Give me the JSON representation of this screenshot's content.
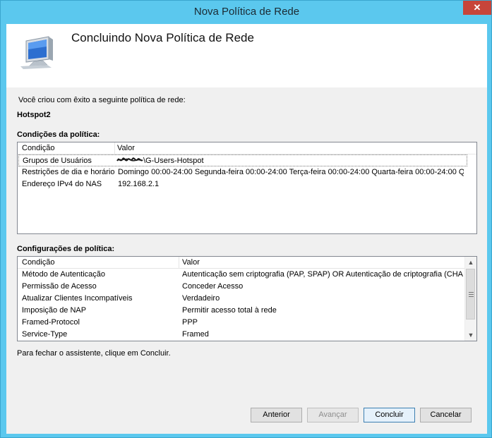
{
  "window": {
    "title": "Nova Política de Rede",
    "close_symbol": "✕"
  },
  "header": {
    "title": "Concluindo Nova Política de Rede",
    "icon": "monitor-icon"
  },
  "intro_text": "Você criou com êxito a seguinte política de rede:",
  "policy_name": "Hotspot2",
  "conditions": {
    "section_label": "Condições da política:",
    "columns": [
      "Condição",
      "Valor"
    ],
    "rows": [
      {
        "condition": "Grupos de Usuários",
        "value": "\\G-Users-Hotspot"
      },
      {
        "condition": "Restrições de dia e horário",
        "value": "Domingo 00:00-24:00 Segunda-feira 00:00-24:00 Terça-feira 00:00-24:00 Quarta-feira 00:00-24:00 Q..."
      },
      {
        "condition": "Endereço IPv4 do NAS",
        "value": "192.168.2.1"
      }
    ]
  },
  "settings": {
    "section_label": "Configurações de política:",
    "columns": [
      "Condição",
      "Valor"
    ],
    "rows": [
      {
        "condition": "Método de Autenticação",
        "value": "Autenticação sem criptografia (PAP, SPAP) OR Autenticação de criptografia (CHA..."
      },
      {
        "condition": "Permissão de Acesso",
        "value": "Conceder Acesso"
      },
      {
        "condition": "Atualizar Clientes Incompatíveis",
        "value": "Verdadeiro"
      },
      {
        "condition": "Imposição de NAP",
        "value": "Permitir acesso total à rede"
      },
      {
        "condition": "Framed-Protocol",
        "value": "PPP"
      },
      {
        "condition": "Service-Type",
        "value": "Framed"
      }
    ]
  },
  "footer_text": "Para fechar o assistente, clique em Concluir.",
  "buttons": {
    "back": "Anterior",
    "next": "Avançar",
    "finish": "Concluir",
    "cancel": "Cancelar"
  },
  "colors": {
    "frame": "#5bc8ee",
    "close": "#c7453a"
  }
}
